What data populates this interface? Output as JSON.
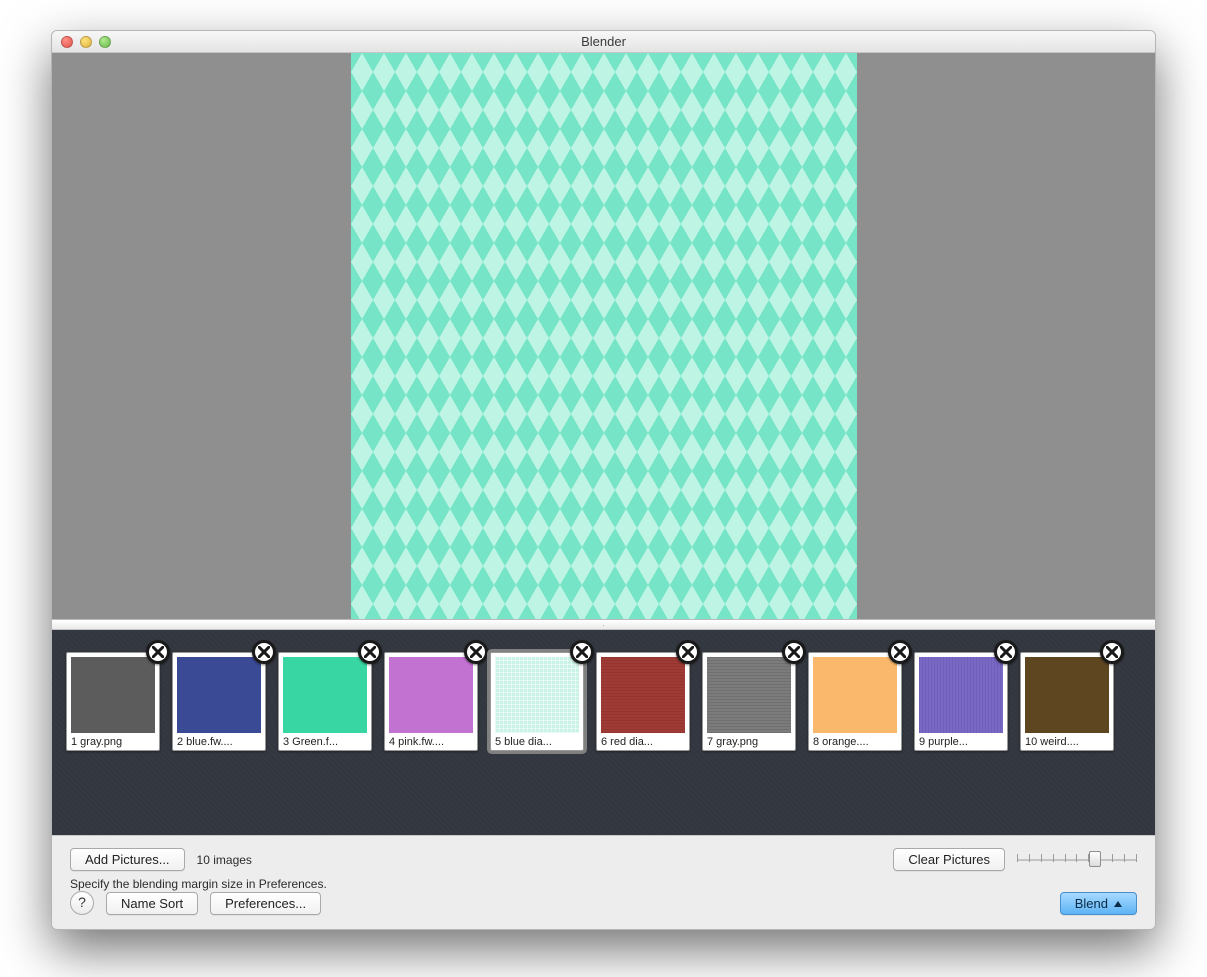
{
  "window": {
    "title": "Blender"
  },
  "thumbnails": [
    {
      "label": "1 gray.png",
      "swatchClass": "sw-gray",
      "selected": false
    },
    {
      "label": "2 blue.fw....",
      "swatchClass": "sw-blue",
      "selected": false
    },
    {
      "label": "3 Green.f...",
      "swatchClass": "sw-green",
      "selected": false
    },
    {
      "label": "4 pink.fw....",
      "swatchClass": "sw-pink",
      "selected": false
    },
    {
      "label": "5 blue dia...",
      "swatchClass": "sw-bluedia",
      "selected": true
    },
    {
      "label": "6 red dia...",
      "swatchClass": "sw-reddia",
      "selected": false
    },
    {
      "label": "7 gray.png",
      "swatchClass": "sw-gray2",
      "selected": false
    },
    {
      "label": "8 orange....",
      "swatchClass": "sw-orange",
      "selected": false
    },
    {
      "label": "9 purple...",
      "swatchClass": "sw-purple",
      "selected": false
    },
    {
      "label": "10 weird....",
      "swatchClass": "sw-weird",
      "selected": false
    }
  ],
  "toolbar": {
    "addPictures": "Add Pictures...",
    "countText": "10 images",
    "hint": "Specify the blending margin size in Preferences.",
    "clearPictures": "Clear Pictures",
    "help": "?",
    "nameSort": "Name Sort",
    "preferences": "Preferences...",
    "blend": "Blend",
    "sliderPercent": 65
  }
}
